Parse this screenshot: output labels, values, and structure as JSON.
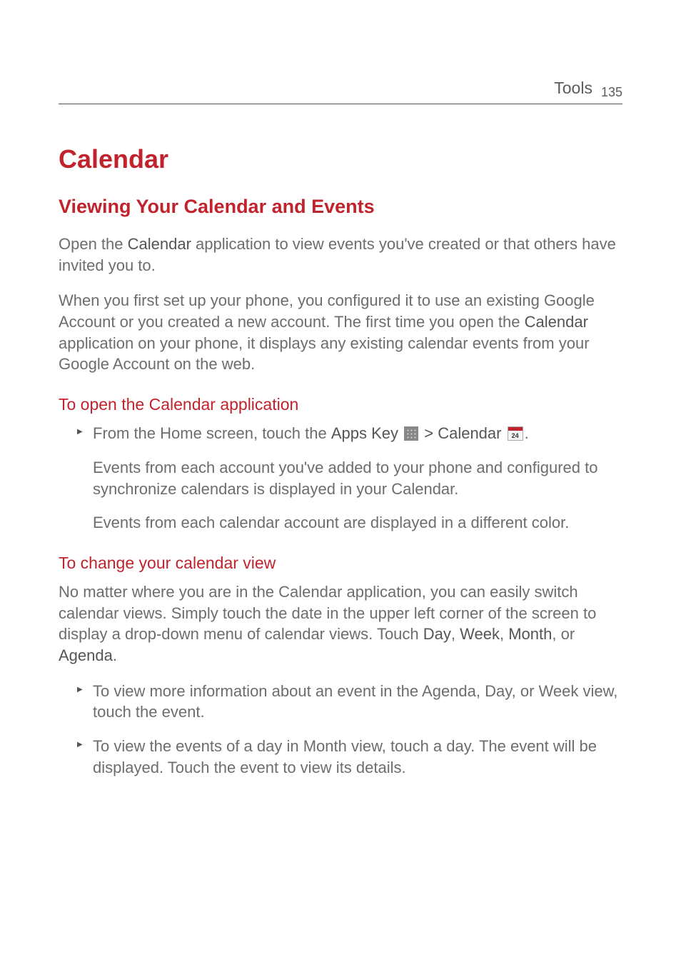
{
  "header": {
    "section": "Tools",
    "page": "135"
  },
  "h1": "Calendar",
  "h2": "Viewing Your Calendar and Events",
  "para1_prefix": "Open the ",
  "para1_strong": "Calendar",
  "para1_suffix": " application to view events you've created or that others have invited you to.",
  "para2_prefix": "When you first set up your phone, you configured it to use an existing Google Account or you created a new account. The first time you open the ",
  "para2_strong": "Calendar",
  "para2_suffix": " application on your phone, it displays any existing calendar events from your Google Account on the web.",
  "h3a": "To open the Calendar application",
  "bullet1_a": "From the Home screen, touch the ",
  "bullet1_b": "Apps Key",
  "bullet1_c": " > ",
  "bullet1_d": "Calendar",
  "bullet1_e": ".",
  "sub1": "Events from each account you've added to your phone and configured to synchronize calendars is displayed in your Calendar.",
  "sub2": "Events from each calendar account are displayed in a different color.",
  "h3b": "To change your calendar view",
  "para3_a": "No matter where you are in the Calendar application, you can easily switch calendar views. Simply touch the date in the upper left corner of the screen to display a drop-down menu of calendar views. Touch ",
  "para3_b": "Day",
  "para3_c": ", ",
  "para3_d": "Week",
  "para3_e": ", ",
  "para3_f": "Month",
  "para3_g": ", or ",
  "para3_h": "Agenda",
  "para3_i": ".",
  "bullet2": "To view more information about an event in the Agenda, Day, or Week view, touch the event.",
  "bullet3": "To view the events of a day in Month view, touch a day. The event will be displayed. Touch the event to view its details."
}
